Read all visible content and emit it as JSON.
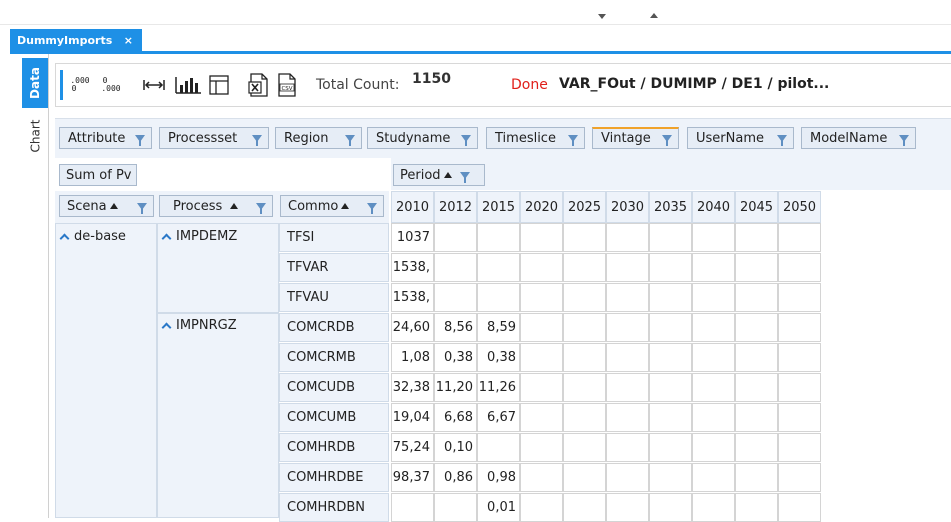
{
  "top": {
    "nav_down_icon": "triangle-down",
    "nav_up_icon": "triangle-up"
  },
  "document_tab": {
    "title": "DummyImports",
    "close": "×"
  },
  "side_tabs": {
    "data": "Data",
    "chart": "Chart"
  },
  "toolbar": {
    "decimals_increase": {
      "top": ".000",
      "bottom": "0"
    },
    "decimals_decrease": {
      "top": "0",
      "bottom": ".000"
    },
    "icons": [
      "increase-decimals-icon",
      "decrease-decimals-icon",
      "fit-width-icon",
      "bar-chart-icon",
      "layout-table-icon",
      "export-excel-icon",
      "export-csv-icon"
    ],
    "total_count_label": "Total Count:",
    "total_count_value": "1150",
    "status": "Done",
    "path": "VAR_FOut / DUMIMP / DE1 / pilot..."
  },
  "filters": [
    "Attribute",
    "Processset",
    "Region",
    "Studyname",
    "Timeslice",
    "Vintage",
    "UserName",
    "ModelName"
  ],
  "pivot": {
    "data_field": "Sum of Pv",
    "column_field": "Period",
    "row_fields": [
      "Scena",
      "Process",
      "Commo"
    ],
    "years": [
      "2010",
      "2012",
      "2015",
      "2020",
      "2025",
      "2030",
      "2035",
      "2040",
      "2045",
      "2050"
    ],
    "scenario": "de-base",
    "processes": [
      {
        "name": "IMPDEMZ"
      },
      {
        "name": "IMPNRGZ"
      }
    ],
    "rows": [
      {
        "commodity": "TFSI",
        "values": [
          "1037",
          "",
          "",
          "",
          "",
          "",
          "",
          "",
          "",
          ""
        ]
      },
      {
        "commodity": "TFVAR",
        "values": [
          "1538,",
          "",
          "",
          "",
          "",
          "",
          "",
          "",
          "",
          ""
        ]
      },
      {
        "commodity": "TFVAU",
        "values": [
          "1538,",
          "",
          "",
          "",
          "",
          "",
          "",
          "",
          "",
          ""
        ]
      },
      {
        "commodity": "COMCRDB",
        "values": [
          "24,60",
          "8,56",
          "8,59",
          "",
          "",
          "",
          "",
          "",
          "",
          ""
        ]
      },
      {
        "commodity": "COMCRMB",
        "values": [
          "1,08",
          "0,38",
          "0,38",
          "",
          "",
          "",
          "",
          "",
          "",
          ""
        ]
      },
      {
        "commodity": "COMCUDB",
        "values": [
          "32,38",
          "11,20",
          "11,26",
          "",
          "",
          "",
          "",
          "",
          "",
          ""
        ]
      },
      {
        "commodity": "COMCUMB",
        "values": [
          "19,04",
          "6,68",
          "6,67",
          "",
          "",
          "",
          "",
          "",
          "",
          ""
        ]
      },
      {
        "commodity": "COMHRDB",
        "values": [
          "75,24",
          "0,10",
          "",
          "",
          "",
          "",
          "",
          "",
          "",
          ""
        ]
      },
      {
        "commodity": "COMHRDBE",
        "values": [
          "98,37",
          "0,86",
          "0,98",
          "",
          "",
          "",
          "",
          "",
          "",
          ""
        ]
      },
      {
        "commodity": "COMHRDBN",
        "values": [
          "",
          "",
          "0,01",
          "",
          "",
          "",
          "",
          "",
          "",
          ""
        ]
      }
    ]
  }
}
